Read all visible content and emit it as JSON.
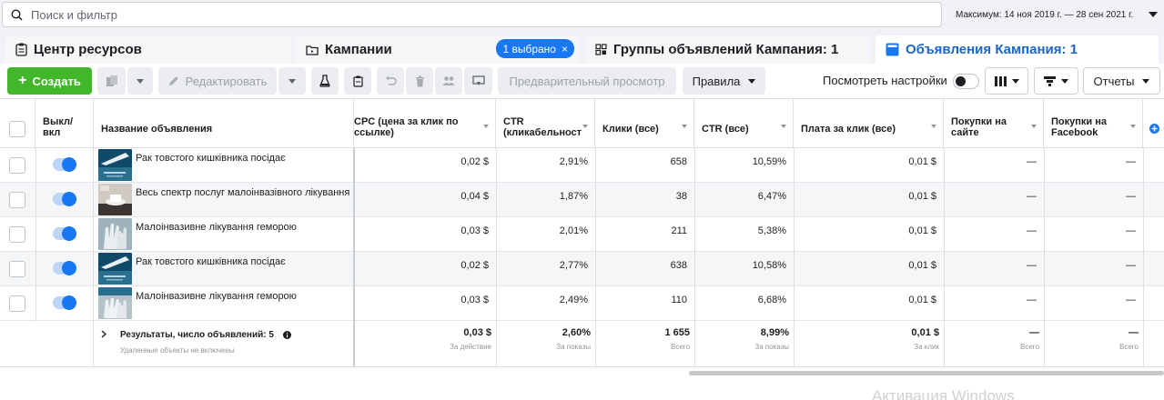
{
  "search": {
    "placeholder": "Поиск и фильтр",
    "icon": "search-icon"
  },
  "date_range": "Максимум: 14 ноя 2019 г. — 28 сен 2021 г.",
  "tabs": [
    {
      "label": "Центр ресурсов",
      "icon": "clipboard-icon"
    },
    {
      "label": "Кампании",
      "icon": "folder-icon",
      "badge": "1 выбрано",
      "badge_close": "×"
    },
    {
      "label": "Группы объявлений Кампания: 1",
      "icon": "grid-icon"
    },
    {
      "label": "Объявления Кампания: 1",
      "icon": "ad-square-icon"
    }
  ],
  "toolbar": {
    "create_label": "Создать",
    "create_plus": "+",
    "edit_label": "Редактировать",
    "preview_label": "Предварительный просмотр",
    "rules_label": "Правила",
    "view_settings_label": "Посмотреть настройки",
    "reports_label": "Отчеты"
  },
  "columns": [
    "Выкл/ вкл",
    "Название объявления",
    "CPC (цена за клик по ссылке)",
    "CTR (кликабельност",
    "Клики (все)",
    "CTR (все)",
    "Плата за клик (все)",
    "Покупки на сайте",
    "Покупки на Facebook"
  ],
  "rows": [
    {
      "name": "Рак товстого кишківника посідає",
      "cpc": "0,02 $",
      "ctr": "2,91%",
      "clicks": "658",
      "ctr_all": "10,59%",
      "cpc_all": "0,01 $",
      "site": "—",
      "fb": "—",
      "on": true
    },
    {
      "name": "Весь спектр послуг малоінвазівного лікування",
      "cpc": "0,04 $",
      "ctr": "1,87%",
      "clicks": "38",
      "ctr_all": "6,47%",
      "cpc_all": "0,01 $",
      "site": "—",
      "fb": "—",
      "on": true
    },
    {
      "name": "Малоінвазивне лікування геморою",
      "cpc": "0,03 $",
      "ctr": "2,01%",
      "clicks": "211",
      "ctr_all": "5,38%",
      "cpc_all": "0,01 $",
      "site": "—",
      "fb": "—",
      "on": true
    },
    {
      "name": "Рак товстого кишківника посідає",
      "cpc": "0,02 $",
      "ctr": "2,77%",
      "clicks": "638",
      "ctr_all": "10,58%",
      "cpc_all": "0,01 $",
      "site": "—",
      "fb": "—",
      "on": true
    },
    {
      "name": "Малоінвазивне лікування геморою",
      "cpc": "0,03 $",
      "ctr": "2,49%",
      "clicks": "110",
      "ctr_all": "6,68%",
      "cpc_all": "0,01 $",
      "site": "—",
      "fb": "—",
      "on": true
    }
  ],
  "footer": {
    "title": "Результаты, число объявлений: 5",
    "subtitle": "Удаленные объекты не включены",
    "cpc": "0,03 $",
    "cpc_sub": "За действие",
    "ctr": "2,60%",
    "ctr_sub": "За показы",
    "clicks": "1 655",
    "clicks_sub": "Всего",
    "ctr_all": "8,99%",
    "ctr_all_sub": "За показы",
    "cpc_all": "0,01 $",
    "cpc_all_sub": "За клик",
    "site": "—",
    "site_sub": "Всего",
    "fb": "—",
    "fb_sub": "Всего"
  },
  "watermark": "Активация Windows",
  "colors": {
    "accent": "#1877f2",
    "create": "#42b72a",
    "active_tab": "#1a66c6"
  }
}
